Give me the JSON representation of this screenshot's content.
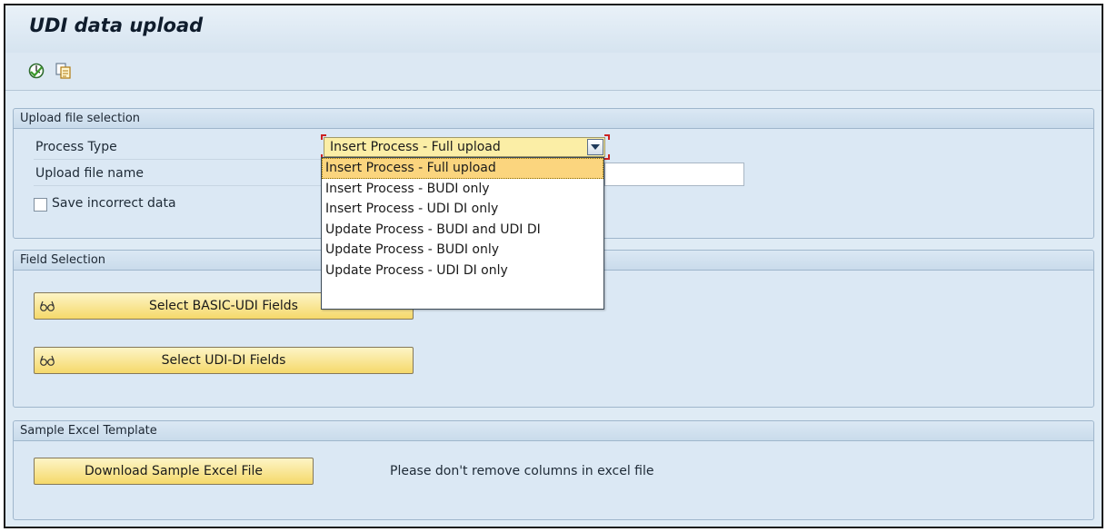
{
  "window": {
    "title": "UDI data upload"
  },
  "toolbar": {
    "execute_icon": "execute-icon",
    "variant_icon": "get-variant-icon"
  },
  "upload_file_selection": {
    "header": "Upload file selection",
    "process_type_label": "Process Type",
    "process_type_value": "Insert Process - Full upload",
    "upload_file_label": "Upload file name",
    "upload_file_value": "",
    "save_incorrect_label": "Save incorrect data",
    "save_incorrect_checked": false
  },
  "dropdown": {
    "options": [
      "Insert Process - Full upload",
      "Insert Process - BUDI only",
      "Insert Process - UDI DI only",
      "Update Process - BUDI and UDI DI",
      "Update Process - BUDI only",
      "Update Process - UDI DI only"
    ],
    "selected_index": 0
  },
  "field_selection": {
    "header": "Field Selection",
    "basic_udi_button": "Select BASIC-UDI Fields",
    "udi_di_button": "Select UDI-DI Fields"
  },
  "sample_template": {
    "header": "Sample Excel Template",
    "download_button": "Download Sample Excel File",
    "note": "Please don't remove columns in excel file"
  },
  "colors": {
    "button_yellow": "#f5d96a",
    "selected_option": "#fbd57e",
    "required_marker": "#cc2222"
  }
}
